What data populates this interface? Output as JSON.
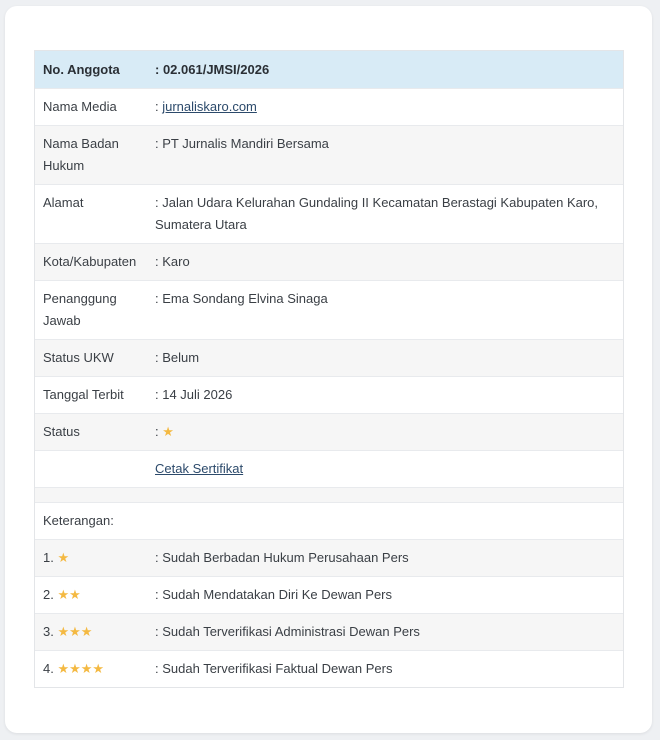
{
  "rows": [
    {
      "label": "No. Anggota",
      "value": ": 02.061/JMSI/2026"
    },
    {
      "label": "Nama Media",
      "prefix": ": ",
      "link": "jurnaliskaro.com"
    },
    {
      "label": "Nama Badan Hukum",
      "value": ": PT Jurnalis Mandiri Bersama"
    },
    {
      "label": "Alamat",
      "value": ": Jalan Udara Kelurahan Gundaling II Kecamatan Berastagi Kabupaten Karo, Sumatera Utara"
    },
    {
      "label": "Kota/Kabupaten",
      "value": ": Karo"
    },
    {
      "label": "Penanggung Jawab",
      "value": ": Ema Sondang Elvina Sinaga"
    },
    {
      "label": "Status UKW",
      "value": ": Belum"
    },
    {
      "label": "Tanggal Terbit",
      "value": ": 14 Juli 2026"
    },
    {
      "label": "Status",
      "prefix": ": ",
      "stars": 1
    },
    {
      "link": "Cetak Sertifikat"
    }
  ],
  "keterangan": {
    "title": "Keterangan:",
    "items": [
      {
        "num": "1.",
        "stars": 1,
        "desc": ": Sudah Berbadan Hukum Perusahaan Pers"
      },
      {
        "num": "2.",
        "stars": 2,
        "desc": ": Sudah Mendatakan Diri Ke Dewan Pers"
      },
      {
        "num": "3.",
        "stars": 3,
        "desc": ": Sudah Terverifikasi Administrasi Dewan Pers"
      },
      {
        "num": "4.",
        "stars": 4,
        "desc": ": Sudah Terverifikasi Faktual Dewan Pers"
      }
    ]
  },
  "colors": {
    "header_bg": "#d8ebf6",
    "star": "#f4b942",
    "link": "#2c4a6b"
  },
  "icons": {
    "star": "star-icon"
  }
}
